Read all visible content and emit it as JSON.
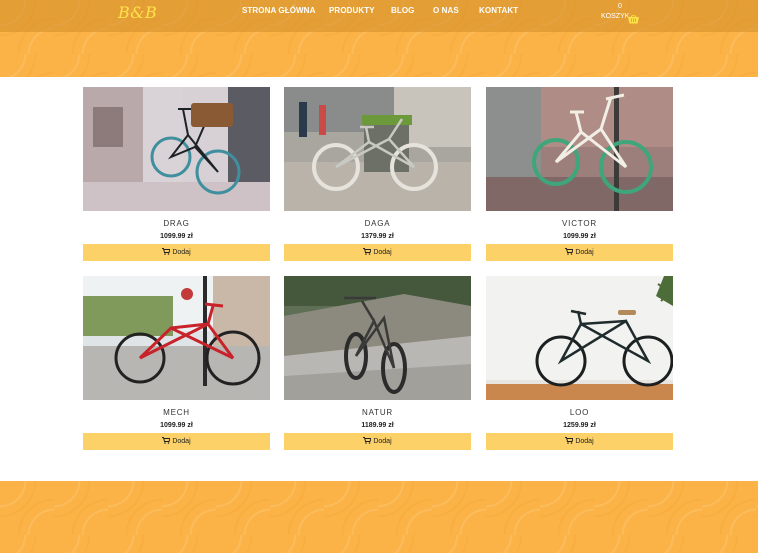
{
  "brand": {
    "logo": "B&B"
  },
  "nav": {
    "items": [
      {
        "label": "STRONA GŁÓWNA"
      },
      {
        "label": "PRODUKTY"
      },
      {
        "label": "BLOG"
      },
      {
        "label": "O NAS"
      },
      {
        "label": "KONTAKT"
      }
    ]
  },
  "cart": {
    "count": "0",
    "label": "KOSZYK",
    "icon": "shopping-basket-icon"
  },
  "products": [
    {
      "name": "DRAG",
      "price": "1099.99 zł",
      "button": "Dodaj",
      "bike_color": "#3f8f9f"
    },
    {
      "name": "DAGA",
      "price": "1379.99 zł",
      "button": "Dodaj",
      "bike_color": "#c9c9c4"
    },
    {
      "name": "VICTOR",
      "price": "1099.99 zł",
      "button": "Dodaj",
      "bike_color": "#f1eee6"
    },
    {
      "name": "MECH",
      "price": "1099.99 zł",
      "button": "Dodaj",
      "bike_color": "#c8232a"
    },
    {
      "name": "NATUR",
      "price": "1189.99 zł",
      "button": "Dodaj",
      "bike_color": "#3a3a3a"
    },
    {
      "name": "LOO",
      "price": "1259.99 zł",
      "button": "Dodaj",
      "bike_color": "#1f2b2c"
    }
  ],
  "colors": {
    "accent": "#fbb347",
    "button": "#fcd168",
    "logo": "#ffe24a"
  }
}
